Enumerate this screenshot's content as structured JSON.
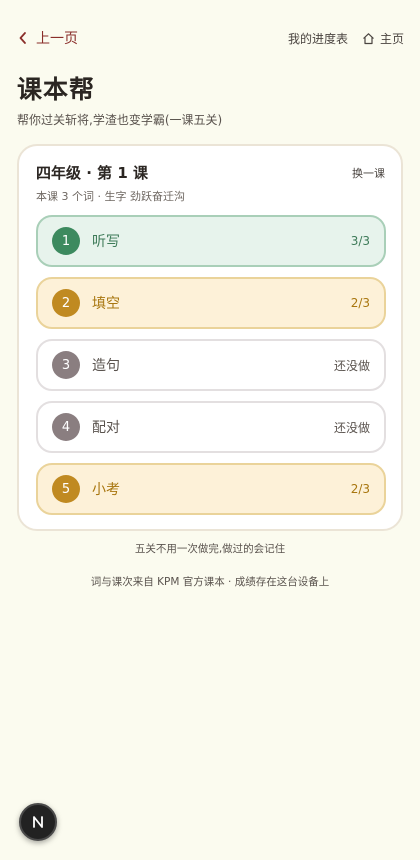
{
  "nav": {
    "back_label": "上一页",
    "progress_label": "我的进度表",
    "home_label": "主页"
  },
  "app": {
    "title": "课本帮",
    "subtitle": "帮你过关斩将,学渣也变学霸(一课五关)"
  },
  "card": {
    "lesson": "四年级 · 第 1 课",
    "switch_label": "换一课",
    "info": "本课 3 个词 · 生字 劲跃奋迁沟",
    "steps": [
      {
        "num": "1",
        "label": "听写",
        "status": "3/3",
        "state": "done"
      },
      {
        "num": "2",
        "label": "填空",
        "status": "2/3",
        "state": "partial"
      },
      {
        "num": "3",
        "label": "造句",
        "status": "还没做",
        "state": "todo"
      },
      {
        "num": "4",
        "label": "配对",
        "status": "还没做",
        "state": "todo"
      },
      {
        "num": "5",
        "label": "小考",
        "status": "2/3",
        "state": "partial"
      }
    ]
  },
  "notes": {
    "line1": "五关不用一次做完,做过的会记住",
    "line2": "词与课次来自 KPM 官方课本 · 成绩存在这台设备上"
  },
  "fab": {
    "icon": "n-logo-icon",
    "label": "N"
  },
  "colors": {
    "background": "#fbfbef",
    "accent_red": "#8a2e2a",
    "done_green": "#3d8a5f",
    "partial_amber": "#c08a21",
    "todo_gray": "#8a7e80"
  }
}
